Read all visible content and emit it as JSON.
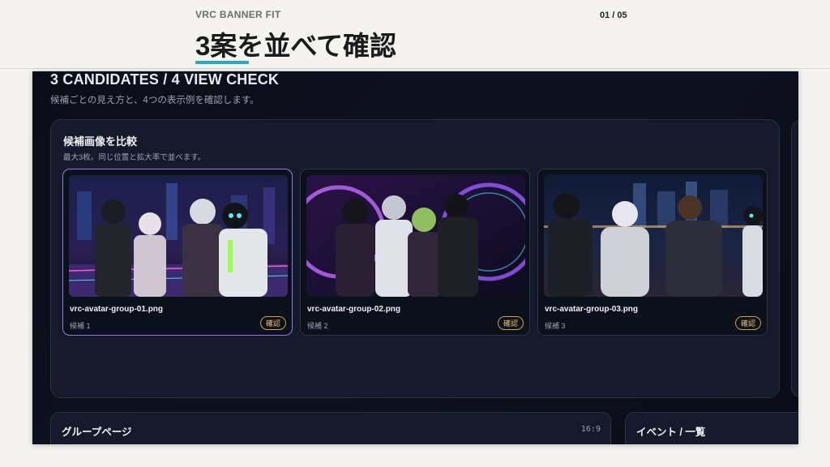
{
  "header": {
    "eyebrow": "VRC BANNER FIT",
    "title": "3案を並べて確認",
    "page_counter": "01 / 05"
  },
  "app": {
    "heading": "3 CANDIDATES / 4 VIEW CHECK",
    "subheading": "候補ごとの見え方と、4つの表示例を確認します。",
    "compare_panel": {
      "title": "候補画像を比較",
      "subtitle": "最大3枚。同じ位置と拡大率で並べます。",
      "candidates": [
        {
          "filename": "vrc-avatar-group-01.png",
          "label": "候補 1",
          "badge": "確認",
          "selected": true
        },
        {
          "filename": "vrc-avatar-group-02.png",
          "label": "候補 2",
          "badge": "確認",
          "selected": false
        },
        {
          "filename": "vrc-avatar-group-03.png",
          "label": "候補 3",
          "badge": "確認",
          "selected": false
        }
      ]
    },
    "bottom_cards": [
      {
        "title": "グループページ",
        "ratio": "16:9"
      },
      {
        "title": "イベント / 一覧",
        "ratio": ""
      }
    ]
  },
  "colors": {
    "accent_teal": "#2aa8bd",
    "selected_border": "#8f7ee8",
    "badge_gold": "#e7c36d"
  }
}
